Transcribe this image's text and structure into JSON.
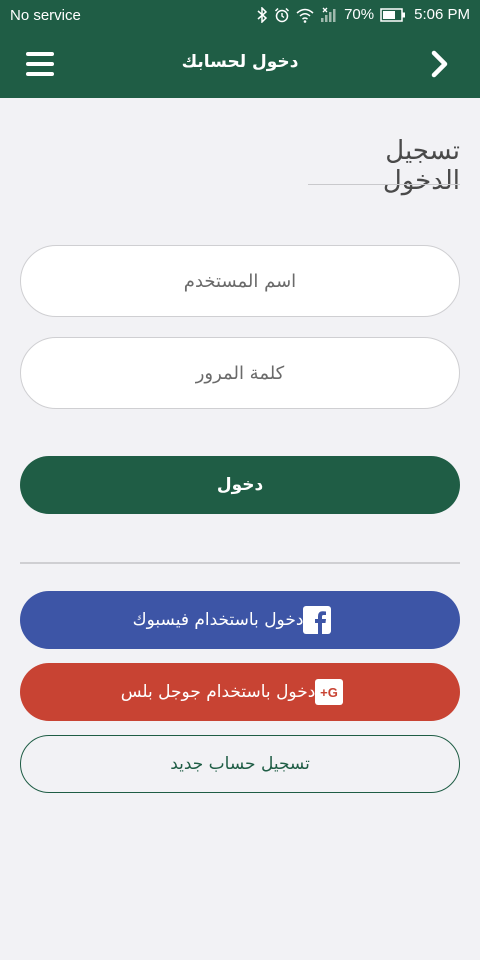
{
  "status_bar": {
    "carrier": "No service",
    "battery": "70%",
    "time": "5:06 PM"
  },
  "app_bar": {
    "title": "دخول لحسابك",
    "menu_icon": "hamburger-icon",
    "back_icon": "chevron-right-icon"
  },
  "section": {
    "title": "تسجيل الدخول"
  },
  "form": {
    "username_placeholder": "اسم المستخدم",
    "password_placeholder": "كلمة المرور",
    "login_label": "دخول"
  },
  "social": {
    "facebook_label": "دخول باستخدام فيسبوك",
    "google_label": "دخول باستخدام جوجل بلس",
    "facebook_icon": "facebook-icon",
    "google_icon": "google-plus-icon"
  },
  "register": {
    "label": "تسجيل حساب جديد"
  },
  "colors": {
    "primary": "#1f5d45",
    "facebook": "#3d55a6",
    "google": "#c84333",
    "background": "#f2f2f5"
  }
}
